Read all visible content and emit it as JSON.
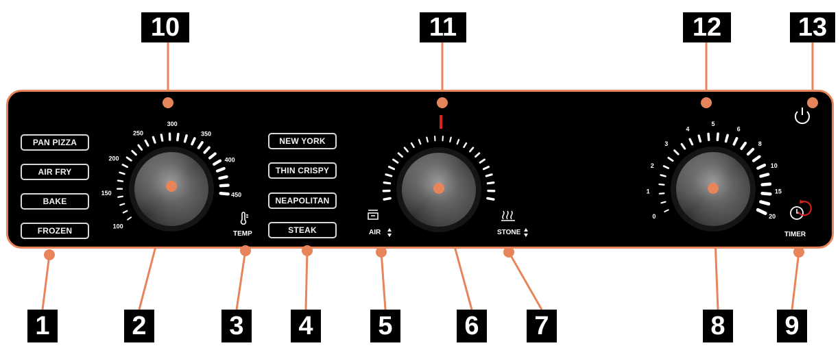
{
  "callouts_top": [
    "10",
    "11",
    "12",
    "13"
  ],
  "callouts_bottom": [
    "1",
    "2",
    "3",
    "4",
    "5",
    "6",
    "7",
    "8",
    "9"
  ],
  "preset_buttons_left": [
    "PAN PIZZA",
    "AIR FRY",
    "BAKE",
    "FROZEN"
  ],
  "preset_buttons_right": [
    "NEW YORK",
    "THIN CRISPY",
    "NEAPOLITAN",
    "STEAK"
  ],
  "temp_dial": {
    "scale_labels": [
      "100",
      "150",
      "200",
      "250",
      "300",
      "350",
      "400",
      "450"
    ],
    "label": "TEMP"
  },
  "heat_dial": {
    "left_label": "AIR",
    "right_label": "STONE"
  },
  "timer_dial": {
    "scale_labels": [
      "0",
      "1",
      "2",
      "3",
      "4",
      "5",
      "6",
      "8",
      "10",
      "15",
      "20"
    ],
    "label": "TIMER"
  },
  "colors": {
    "accent": "#e8845a",
    "panel": "#000000",
    "indicator": "#e0201a"
  },
  "icons": [
    "thermometer-icon",
    "fan-icon",
    "stone-heat-icon",
    "power-icon",
    "timer-icon"
  ]
}
